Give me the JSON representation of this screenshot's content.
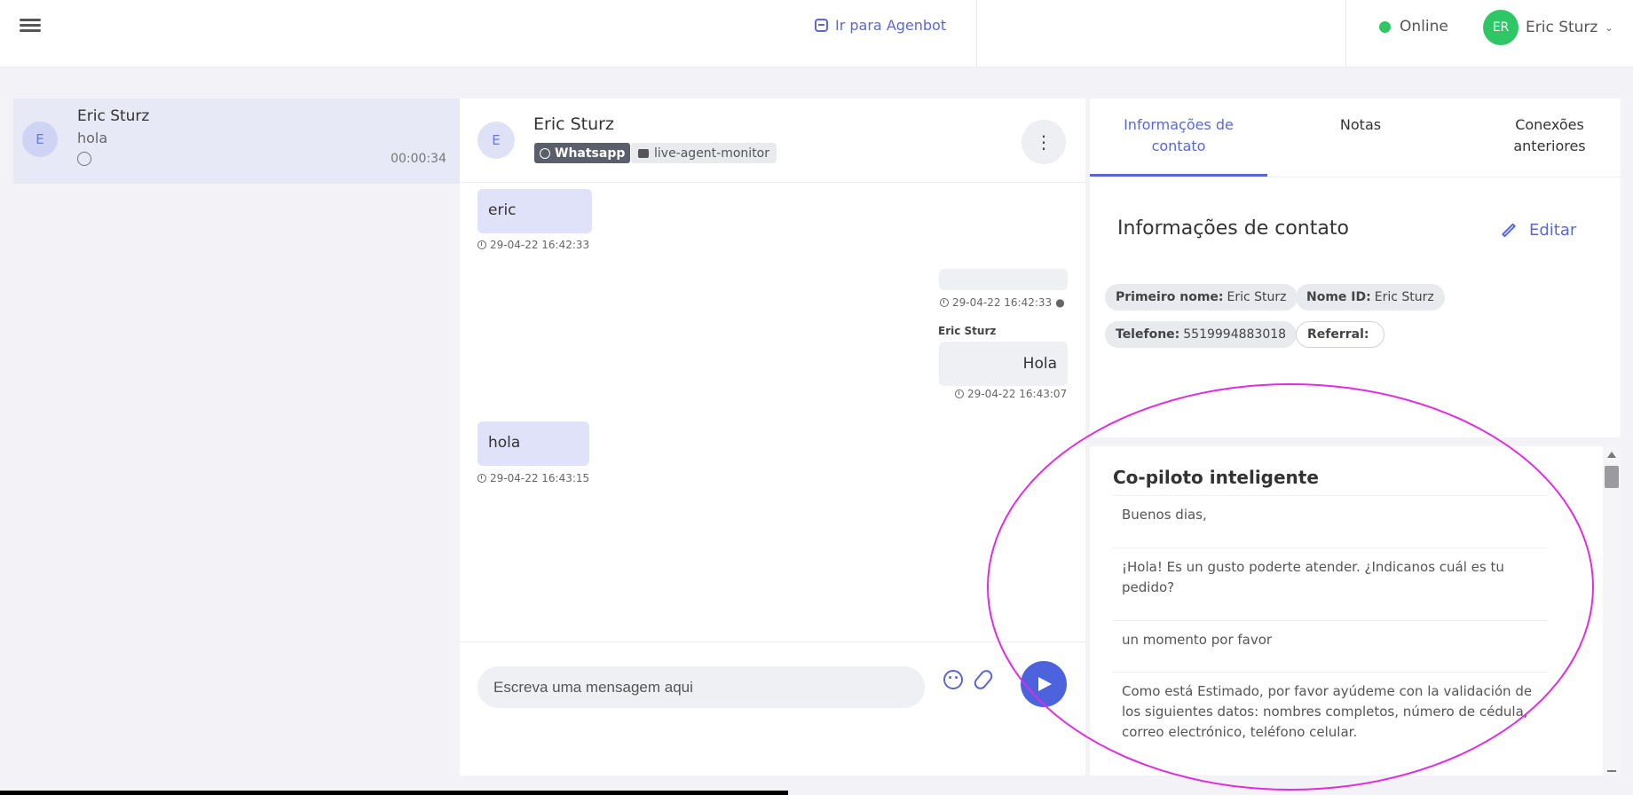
{
  "topbar": {
    "agenbot_link": "Ir para Agenbot",
    "status_label": "Online",
    "user_initials": "ER",
    "user_name": "Eric Sturz",
    "status_color": "#2fc765"
  },
  "conversation_list": [
    {
      "avatar": "E",
      "name": "Eric Sturz",
      "last_message": "hola",
      "channel_icon": "whatsapp-icon",
      "time": "00:00:34"
    }
  ],
  "chat": {
    "avatar": "E",
    "name": "Eric Sturz",
    "channel_chip": "Whatsapp",
    "monitor_chip": "live-agent-monitor",
    "messages": [
      {
        "direction": "in",
        "text": "eric",
        "timestamp": "29-04-22 16:42:33"
      },
      {
        "direction": "out",
        "text": "",
        "timestamp": "29-04-22 16:42:33"
      },
      {
        "direction": "out",
        "sender": "Eric Sturz",
        "text": "Hola",
        "timestamp": "29-04-22 16:43:07"
      },
      {
        "direction": "in",
        "text": "hola",
        "timestamp": "29-04-22 16:43:15"
      }
    ],
    "composer_placeholder": "Escreva uma mensagem aqui"
  },
  "right_panel": {
    "tabs": [
      {
        "label": "Informações de contato",
        "active": true
      },
      {
        "label": "Notas",
        "active": false
      },
      {
        "label": "Conexões anteriores",
        "active": false
      }
    ],
    "section_title": "Informações de contato",
    "edit_label": "Editar",
    "fields": [
      {
        "label": "Primeiro nome:",
        "value": "Eric Sturz"
      },
      {
        "label": "Nome ID:",
        "value": "Eric Sturz"
      },
      {
        "label": "Telefone:",
        "value": "5519994883018"
      },
      {
        "label": "Referral:",
        "value": ""
      }
    ]
  },
  "copilot": {
    "title": "Co-piloto inteligente",
    "suggestions": [
      "Buenos dias,",
      "¡Hola! Es un gusto poderte atender. ¿Indicanos cuál es tu pedido?",
      "un momento por favor",
      "Como está Estimado, por favor ayúdeme con la validación de los siguientes datos: nombres completos, número de cédula, correo electrónico, teléfono celular."
    ]
  },
  "colors": {
    "accent": "#5a68d6",
    "send_button": "#4c63dd",
    "incoming_bubble": "#dfe2f8",
    "annotation": "#e02ce0"
  }
}
